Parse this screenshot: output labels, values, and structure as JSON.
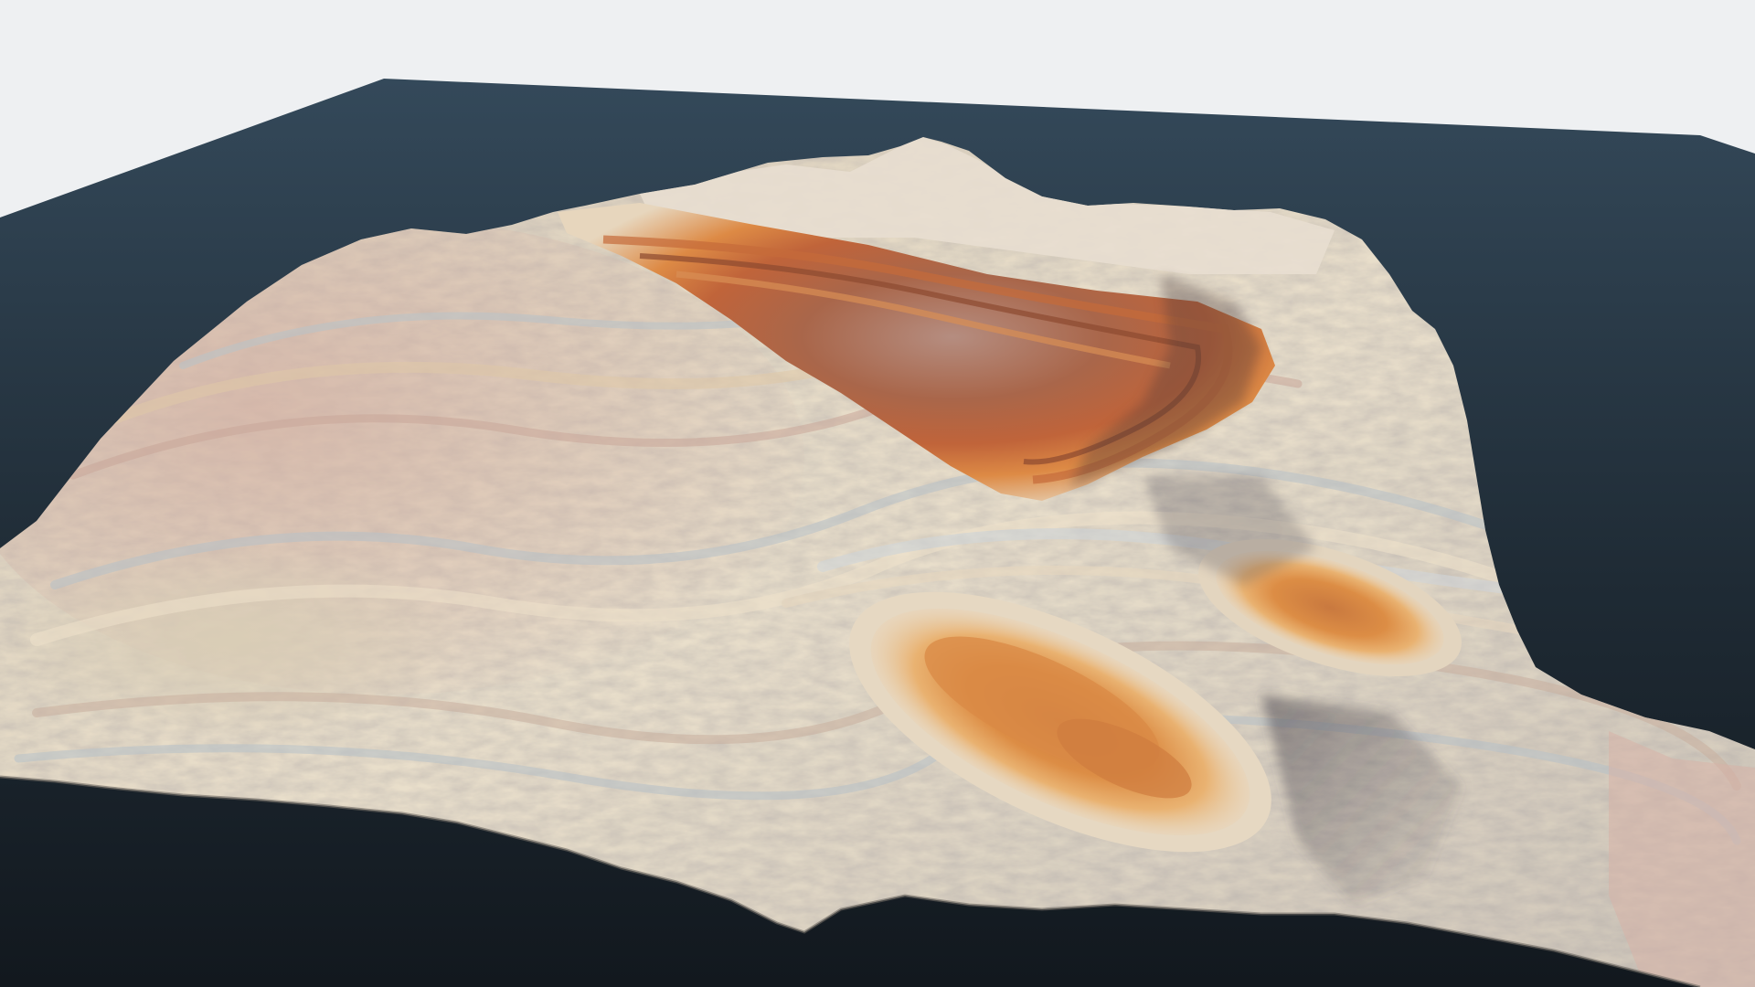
{
  "scene": {
    "kind": "3d-terrain-render",
    "background_color": "#eef0f2",
    "ground_plane_color_far": "#34495a",
    "ground_plane_color_near": "#141b22",
    "terrain_palette": {
      "pale_sandstone": "#e7dcc7",
      "cream_band": "#efe4cf",
      "blue_grey_band": "#b9c2c8",
      "pink_band": "#c9a9a0",
      "orange_band": "#d9893f",
      "rust_band": "#b4623b",
      "deep_rust": "#8d4a30",
      "shadow": "#6f6b70"
    },
    "features": [
      {
        "name": "central-plateau-mesa",
        "color": "rust"
      },
      {
        "name": "northern-ridge-peak",
        "color": "pale"
      },
      {
        "name": "western-slope",
        "color": "pink-cream"
      },
      {
        "name": "southern-orange-mesa",
        "color": "orange"
      },
      {
        "name": "eastern-orange-mesa",
        "color": "orange"
      }
    ]
  }
}
